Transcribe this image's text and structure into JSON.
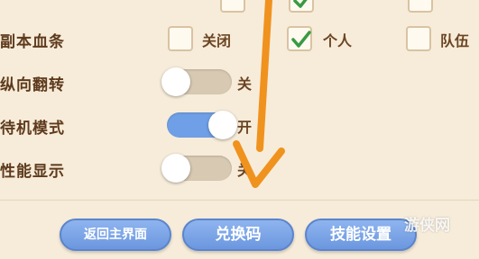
{
  "rows": {
    "dungeon_health_bar": {
      "label": "副本血条",
      "options": [
        {
          "label": "关闭",
          "checked": false
        },
        {
          "label": "个人",
          "checked": true
        },
        {
          "label": "队伍",
          "checked": false
        }
      ]
    },
    "vertical_flip": {
      "label": "纵向翻转",
      "state_text": "关",
      "on": false
    },
    "standby_mode": {
      "label": "待机模式",
      "state_text": "开",
      "on": true
    },
    "performance_display": {
      "label": "性能显示",
      "state_text": "关",
      "on": false
    }
  },
  "buttons": {
    "return_main": "返回主界面",
    "redeem_code": "兑换码",
    "skill_settings": "技能设置"
  },
  "watermark": "游侠网",
  "colors": {
    "background": "#f7ecd9",
    "text": "#5e3a1d",
    "toggle_on": "#6f9fe6",
    "toggle_off": "#d7c9b2",
    "button": "#7aa3e6",
    "check": "#3a9a44",
    "arrow": "#f0921e"
  }
}
